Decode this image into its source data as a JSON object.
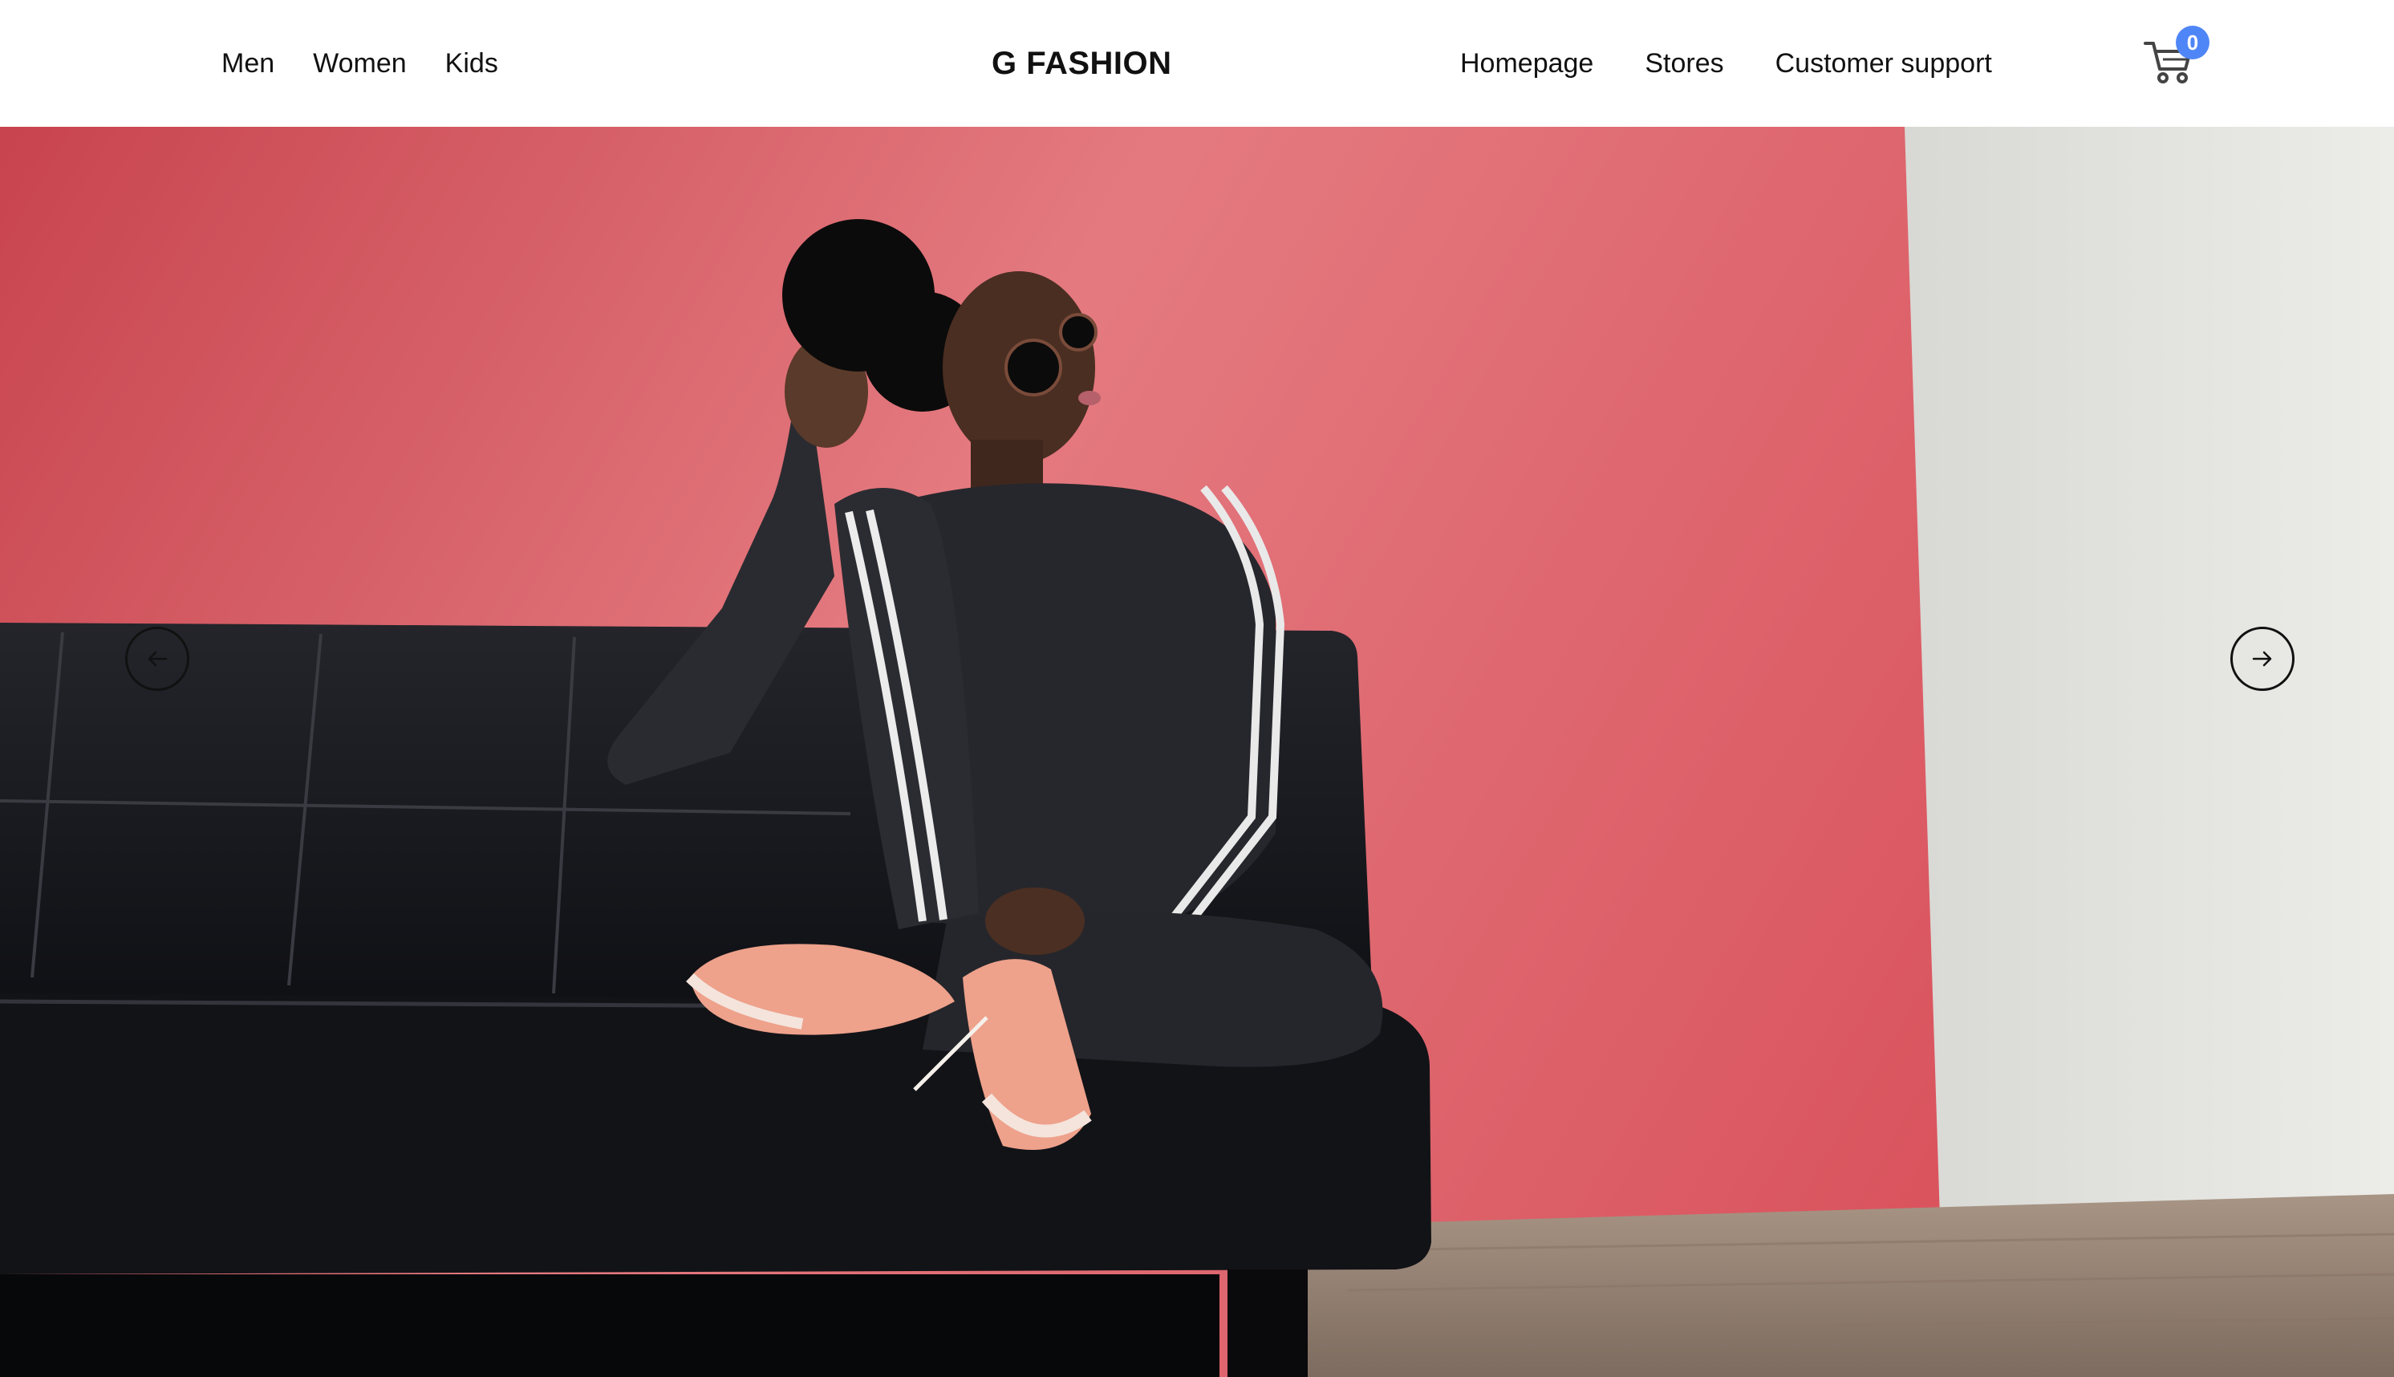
{
  "nav_left": {
    "men": "Men",
    "women": "Women",
    "kids": "Kids"
  },
  "brand": {
    "name": "G FASHION"
  },
  "nav_right": {
    "homepage": "Homepage",
    "stores": "Stores",
    "support": "Customer support"
  },
  "cart": {
    "icon": "cart-icon",
    "count": "0",
    "badge_color": "#4f86f7"
  },
  "hero": {
    "prev_icon": "arrow-left-icon",
    "next_icon": "arrow-right-icon",
    "image": "model-on-black-sofa-photo",
    "colors": {
      "wall_red": "#dd5a63",
      "wall_white": "#e4e4e0",
      "sofa": "#16171b",
      "floor": "#9b8a7e"
    }
  }
}
